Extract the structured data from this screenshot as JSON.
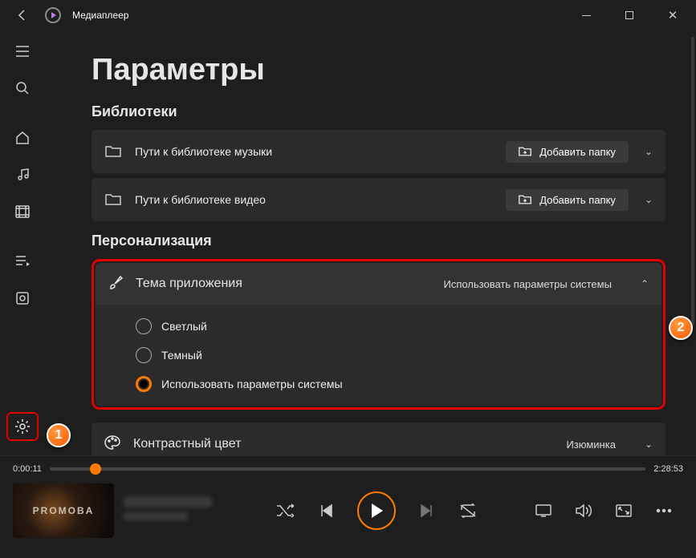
{
  "titlebar": {
    "app_name": "Медиаплеер"
  },
  "page": {
    "title": "Параметры"
  },
  "sections": {
    "libraries": {
      "title": "Библиотеки"
    },
    "personalization": {
      "title": "Персонализация"
    }
  },
  "library_rows": [
    {
      "label": "Пути к библиотеке музыки",
      "button": "Добавить папку"
    },
    {
      "label": "Пути к библиотеке видео",
      "button": "Добавить папку"
    }
  ],
  "theme": {
    "label": "Тема приложения",
    "value": "Использовать параметры системы",
    "options": [
      "Светлый",
      "Темный",
      "Использовать параметры системы"
    ],
    "selected_index": 2
  },
  "accent": {
    "label": "Контрастный цвет",
    "value": "Изюминка"
  },
  "player": {
    "current_time": "0:00:11",
    "total_time": "2:28:53",
    "thumb_text": "PROMOBA"
  },
  "callouts": {
    "badge1": "1",
    "badge2": "2"
  }
}
